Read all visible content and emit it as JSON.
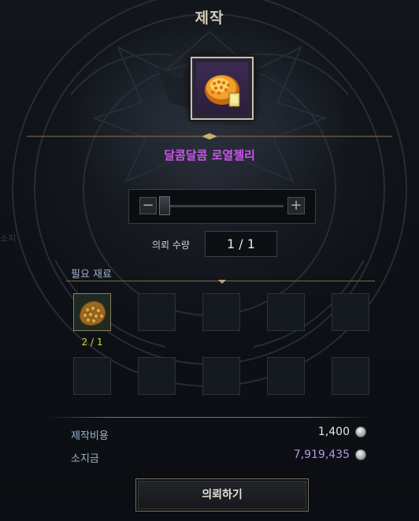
{
  "window": {
    "title": "제작"
  },
  "item": {
    "name": "달콤달콤 로열젤리",
    "icon": "royal-jelly-icon"
  },
  "quantity": {
    "label": "의뢰 수량",
    "value": "1 / 1",
    "minus_icon": "minus-icon",
    "plus_icon": "plus-icon",
    "slider_level": 0
  },
  "materials": {
    "section_label": "필요 재료",
    "slots": [
      {
        "icon": "honeycomb-icon",
        "count": "2 / 1"
      },
      {},
      {},
      {},
      {},
      {},
      {},
      {},
      {},
      {}
    ]
  },
  "cost": {
    "label": "제작비용",
    "value": "1,400",
    "coin_icon": "silver-coin-icon"
  },
  "balance": {
    "label": "소지금",
    "value": "7,919,435",
    "coin_icon": "silver-coin-icon"
  },
  "actions": {
    "craft_label": "의뢰하기"
  },
  "side_text": "소지",
  "colors": {
    "item_name": "#cc55ee",
    "material_count": "#e0d13a",
    "balance_value": "#b898e0",
    "label_blue": "#9fb5cc",
    "accent_gold": "#bda674"
  }
}
